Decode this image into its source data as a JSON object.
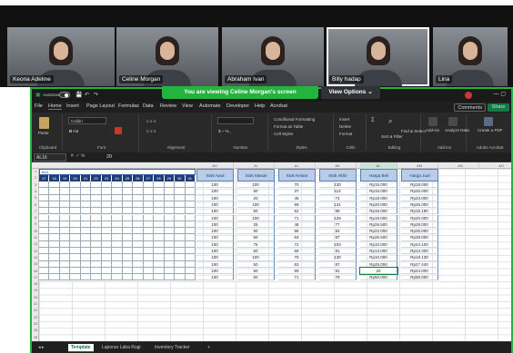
{
  "meeting": {
    "participants": [
      {
        "name": "Keona Adeline"
      },
      {
        "name": "Celine Morgan"
      },
      {
        "name": "Abraham Ivan"
      },
      {
        "name": "Billy hadap"
      },
      {
        "name": "Lina"
      }
    ],
    "banner": "You are viewing  Celine Morgan's screen",
    "view_options": "View Options ⌄"
  },
  "excel": {
    "autosave": "AutoSave",
    "menu": [
      "File",
      "Home",
      "Insert",
      "Page Layout",
      "Formulas",
      "Data",
      "Review",
      "View",
      "Automate",
      "Developer",
      "Help",
      "Acrobat"
    ],
    "comments": "Comments",
    "share": "Share",
    "ribbon_groups": [
      "Clipboard",
      "Font",
      "Alignment",
      "Number",
      "Styles",
      "Cells",
      "Editing",
      "Add-ins",
      "Adobe Acrobat"
    ],
    "ribbon_items": {
      "paste": "Paste",
      "font": "Calibri",
      "find": "Find & Select",
      "sort": "Sort & Filter",
      "format": "Format",
      "create_pdf": "Create a PDF",
      "cond_format": "Conditional Formatting",
      "format_table": "Format as Table",
      "cell_styles": "Cell Styles",
      "insert": "Insert",
      "delete": "Delete",
      "addins": "Add-ins",
      "analyze": "Analyze Data"
    },
    "name_box": "AL16",
    "formula": "20",
    "left_title": "bud",
    "left_headers": [
      "17",
      "18",
      "19",
      "20",
      "21",
      "22",
      "23",
      "24",
      "25",
      "26",
      "27",
      "28",
      "29",
      "30",
      "31"
    ],
    "columns": [
      "AH",
      "AI",
      "AJ",
      "AK",
      "AL",
      "AM",
      "AN",
      "AO"
    ],
    "table_headers": [
      "Stok Awal",
      "Stok Masuk",
      "Stok Keluar",
      "Stok Akhir",
      "Harga Beli",
      "Harga Jual"
    ],
    "rows": [
      [
        "100",
        "100",
        "70",
        "130",
        "Rp15.000",
        "Rp18.000"
      ],
      [
        "100",
        "50",
        "37",
        "113",
        "Rp15.000",
        "Rp25.000"
      ],
      [
        "100",
        "20",
        "46",
        "74",
        "Rp19.000",
        "Rp23.000"
      ],
      [
        "100",
        "100",
        "69",
        "131",
        "Rp20.000",
        "Rp25.000"
      ],
      [
        "100",
        "50",
        "52",
        "98",
        "Rp15.000",
        "Rp15.190"
      ],
      [
        "100",
        "100",
        "71",
        "129",
        "Rp18.000",
        "Rp20.000"
      ],
      [
        "100",
        "25",
        "48",
        "77",
        "Rp26.500",
        "Rp28.000"
      ],
      [
        "100",
        "50",
        "66",
        "84",
        "Rp22.000",
        "Rp25.000"
      ],
      [
        "100",
        "50",
        "63",
        "87",
        "Rp26.500",
        "Rp28.000"
      ],
      [
        "100",
        "75",
        "72",
        "103",
        "Rp10.000",
        "Rp44.100"
      ],
      [
        "100",
        "50",
        "69",
        "81",
        "Rp13.000",
        "Rp13.300"
      ],
      [
        "100",
        "100",
        "70",
        "130",
        "Rp10.000",
        "Rp18.130"
      ],
      [
        "100",
        "50",
        "63",
        "87",
        "Rp25.000",
        "Rp27.440"
      ],
      [
        "100",
        "50",
        "59",
        "91",
        "20",
        "Rp24.000"
      ],
      [
        "100",
        "50",
        "71",
        "79",
        "Rp50.000",
        "Rp55.000"
      ]
    ],
    "sheet_tabs": [
      "Template",
      "Laporan Laba Rugi",
      "Inventory Tracker"
    ]
  }
}
